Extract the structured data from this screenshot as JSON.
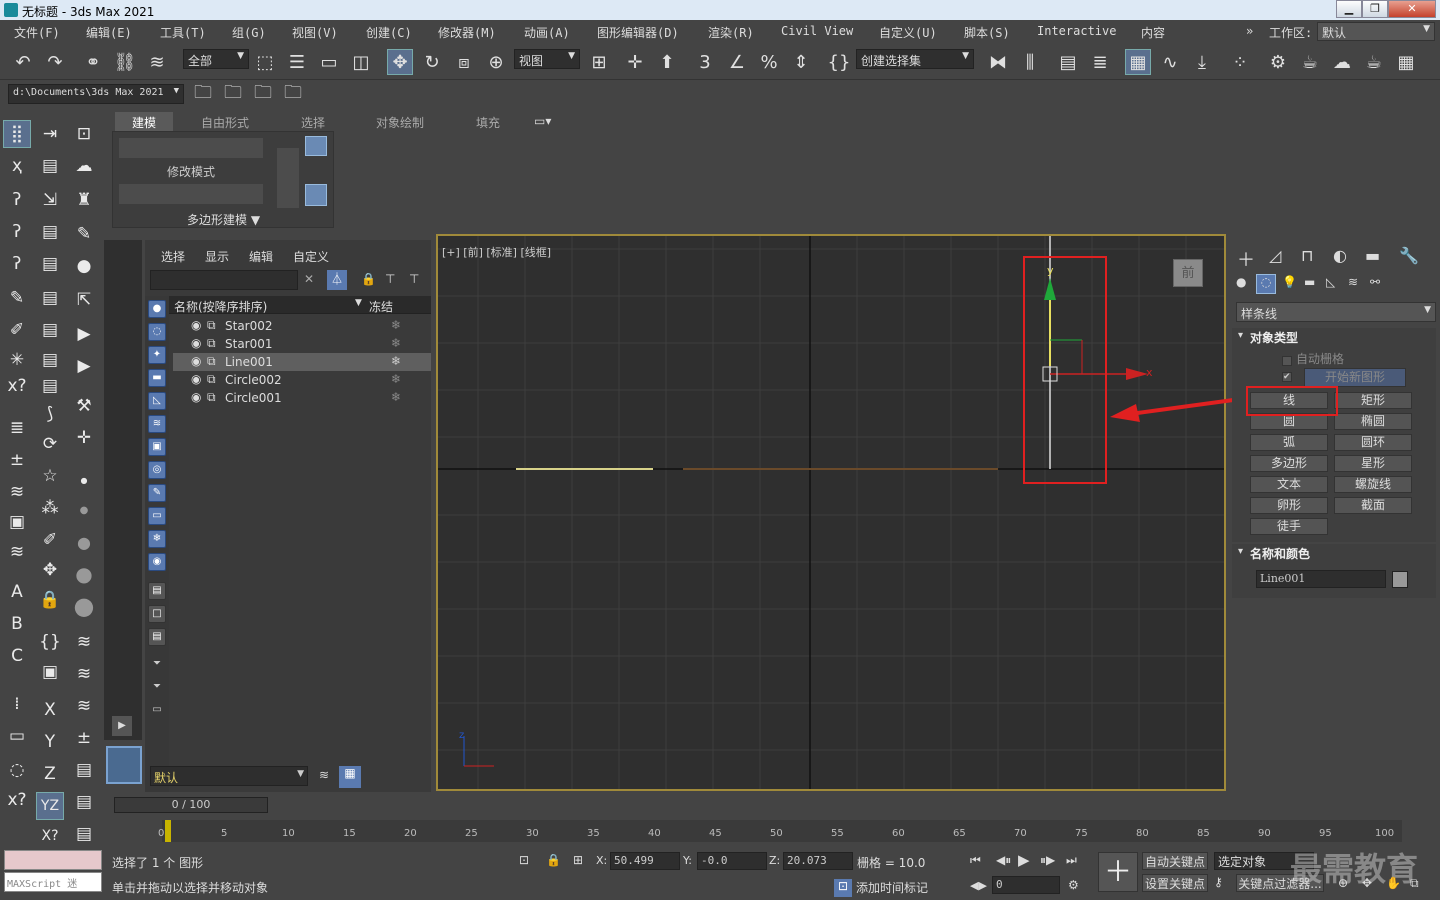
{
  "window": {
    "title": "无标题 - 3ds Max 2021"
  },
  "menu": [
    "文件(F)",
    "编辑(E)",
    "工具(T)",
    "组(G)",
    "视图(V)",
    "创建(C)",
    "修改器(M)",
    "动画(A)",
    "图形编辑器(D)",
    "渲染(R)",
    "Civil View",
    "自定义(U)",
    "脚本(S)",
    "Interactive",
    "内容"
  ],
  "workspace": {
    "label": "工作区:",
    "value": "默认",
    "chevrons": "»"
  },
  "toolbar": {
    "filter": "全部",
    "ref_coord": "视图",
    "selection_set": "创建选择集"
  },
  "project_path": "d:\\Documents\\3ds Max 2021",
  "ribbon": {
    "tabs": [
      "建模",
      "自由形式",
      "选择",
      "对象绘制",
      "填充"
    ],
    "modify_mode": "修改模式",
    "poly_modeling": "多边形建模 ▼"
  },
  "scene_explorer": {
    "menus": [
      "选择",
      "显示",
      "编辑",
      "自定义"
    ],
    "col_name": "名称(按降序排序)",
    "col_freeze": "冻结",
    "items": [
      {
        "name": "Star002",
        "selected": false
      },
      {
        "name": "Star001",
        "selected": false
      },
      {
        "name": "Line001",
        "selected": true
      },
      {
        "name": "Circle002",
        "selected": false
      },
      {
        "name": "Circle001",
        "selected": false
      }
    ],
    "layer": "默认"
  },
  "viewport": {
    "label": "[+] [前] [标准] [线框]",
    "viewcube": "前",
    "axis_y": "y",
    "axis_x": "x",
    "corner_z": "z"
  },
  "command_panel": {
    "category": "样条线",
    "rollout_object_type": "对象类型",
    "auto_grid": "自动栅格",
    "start_new_shape": "开始新图形",
    "buttons": [
      "线",
      "矩形",
      "圆",
      "椭圆",
      "弧",
      "圆环",
      "多边形",
      "星形",
      "文本",
      "螺旋线",
      "卵形",
      "截面",
      "徒手"
    ],
    "rollout_name_color": "名称和颜色",
    "object_name": "Line001"
  },
  "timeline": {
    "frame": "0 / 100",
    "ticks": [
      "0",
      "5",
      "10",
      "15",
      "20",
      "25",
      "30",
      "35",
      "40",
      "45",
      "50",
      "55",
      "60",
      "65",
      "70",
      "75",
      "80",
      "85",
      "90",
      "95",
      "100"
    ]
  },
  "status": {
    "selected": "选择了 1 个 图形",
    "hint": "单击并拖动以选择并移动对象",
    "maxscript": "MAXScript 迷",
    "x_label": "X:",
    "x": "50.499",
    "y_label": "Y:",
    "y": "-0.0",
    "z_label": "Z:",
    "z": "20.073",
    "grid": "栅格 = 10.0",
    "add_time_tag": "添加时间标记",
    "auto_key": "自动关键点",
    "selected_object": "选定对象",
    "set_key": "设置关键点",
    "key_filters": "关键点过滤器...",
    "frame_field": "0",
    "watermark": "最需教育"
  },
  "colors": {
    "highlight_red": "#e02020",
    "viewport_border": "#a08a3a",
    "selection_blue": "#5a7ab0"
  }
}
